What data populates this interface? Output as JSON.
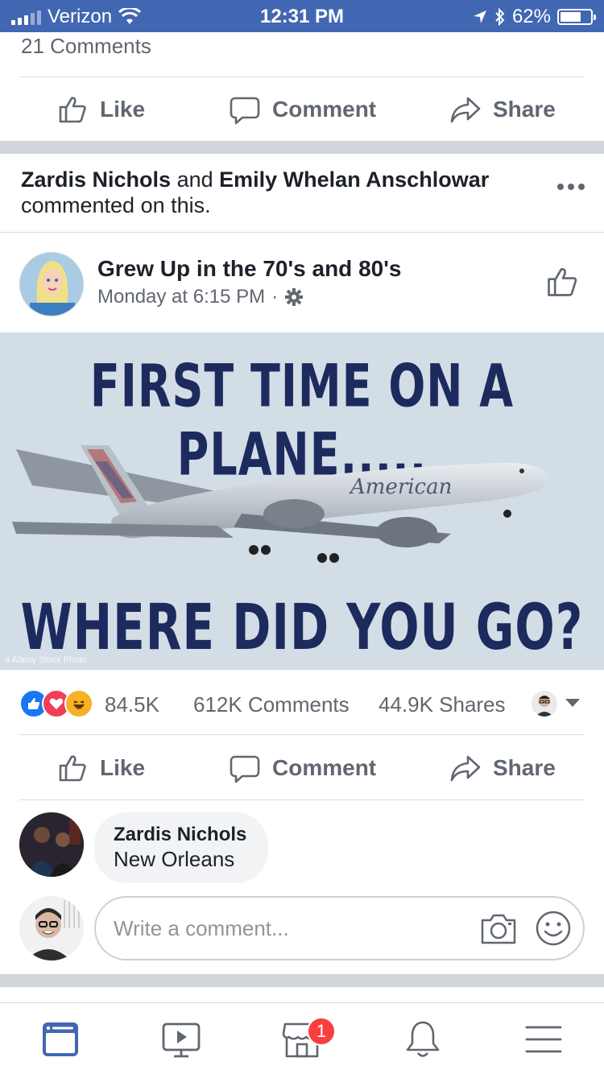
{
  "status_bar": {
    "carrier": "Verizon",
    "time": "12:31 PM",
    "battery": "62%"
  },
  "previous_post": {
    "comments_count": "21 Comments",
    "like_label": "Like",
    "comment_label": "Comment",
    "share_label": "Share"
  },
  "activity": {
    "user1": "Zardis Nichols",
    "joiner": "and",
    "user2": "Emily Whelan Anschlowar",
    "suffix": "commented on this."
  },
  "post": {
    "page_name": "Grew Up in the 70's and 80's",
    "timestamp": "Monday at 6:15 PM",
    "separator": "·",
    "image_text_top": "FIRST TIME ON A PLANE.....",
    "image_text_bottom": "WHERE DID YOU GO?",
    "image_airline": "American",
    "image_watermark": "4 Alamy Stock Photo"
  },
  "stats": {
    "reactions": "84.5K",
    "comments": "612K Comments",
    "shares": "44.9K Shares"
  },
  "actions": {
    "like_label": "Like",
    "comment_label": "Comment",
    "share_label": "Share"
  },
  "comment": {
    "author": "Zardis Nichols",
    "text": "New Orleans"
  },
  "composer": {
    "placeholder": "Write a comment..."
  },
  "tabbar": {
    "notification_badge": "1"
  },
  "colors": {
    "brand": "#4267b2",
    "like_blue": "#1877f2",
    "love_red": "#f33e58",
    "haha_yellow": "#f7b125",
    "badge_red": "#fa3e3e"
  },
  "icons": [
    "signal-icon",
    "wifi-icon",
    "location-icon",
    "bluetooth-icon",
    "battery-icon",
    "thumbs-up-icon",
    "comment-bubble-icon",
    "share-arrow-icon",
    "more-dots-icon",
    "gear-icon",
    "camera-icon",
    "smiley-icon",
    "news-feed-icon",
    "watch-video-icon",
    "marketplace-icon",
    "bell-icon",
    "menu-icon"
  ]
}
